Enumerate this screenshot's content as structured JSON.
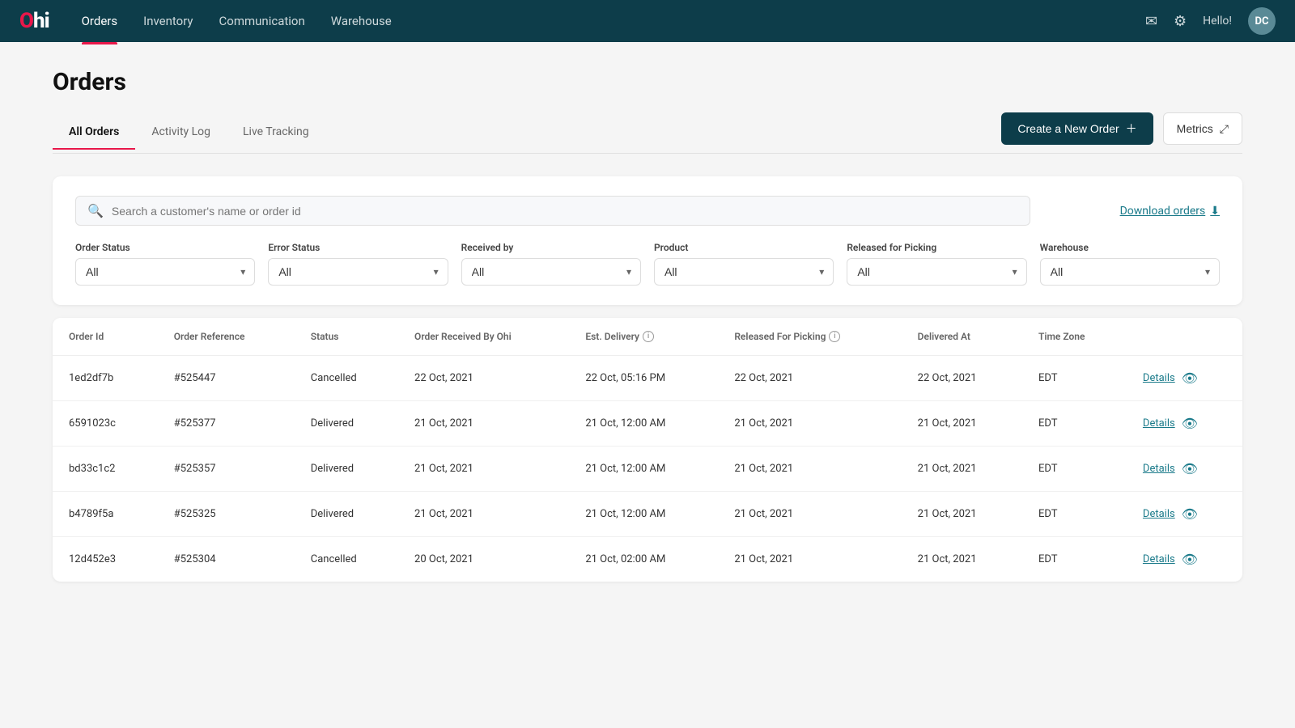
{
  "brand": {
    "logo_o": "O",
    "logo_hi": "hi"
  },
  "nav": {
    "links": [
      {
        "label": "Orders",
        "active": true
      },
      {
        "label": "Inventory",
        "active": false
      },
      {
        "label": "Communication",
        "active": false
      },
      {
        "label": "Warehouse",
        "active": false
      }
    ],
    "greeting": "Hello!",
    "user_initials": "DC"
  },
  "page": {
    "title": "Orders"
  },
  "tabs": [
    {
      "label": "All Orders",
      "active": true
    },
    {
      "label": "Activity Log",
      "active": false
    },
    {
      "label": "Live Tracking",
      "active": false
    }
  ],
  "actions": {
    "create_order": "Create a New Order",
    "metrics": "Metrics"
  },
  "search": {
    "placeholder": "Search a customer's name or order id"
  },
  "download": {
    "label": "Download orders"
  },
  "filters": [
    {
      "label": "Order Status",
      "value": "All"
    },
    {
      "label": "Error Status",
      "value": "All"
    },
    {
      "label": "Received by",
      "value": "All"
    },
    {
      "label": "Product",
      "value": "All"
    },
    {
      "label": "Released for Picking",
      "value": "All"
    },
    {
      "label": "Warehouse",
      "value": "All"
    }
  ],
  "table": {
    "columns": [
      {
        "label": "Order Id"
      },
      {
        "label": "Order Reference"
      },
      {
        "label": "Status"
      },
      {
        "label": "Order Received By Ohi"
      },
      {
        "label": "Est. Delivery",
        "info": true
      },
      {
        "label": "Released For Picking",
        "info": true
      },
      {
        "label": "Delivered At"
      },
      {
        "label": "Time Zone"
      },
      {
        "label": ""
      }
    ],
    "rows": [
      {
        "order_id": "1ed2df7b",
        "order_ref": "#525447",
        "status": "Cancelled",
        "received": "22 Oct, 2021",
        "est_delivery": "22 Oct, 05:16 PM",
        "released": "22 Oct, 2021",
        "delivered": "22 Oct, 2021",
        "timezone": "EDT"
      },
      {
        "order_id": "6591023c",
        "order_ref": "#525377",
        "status": "Delivered",
        "received": "21 Oct, 2021",
        "est_delivery": "21 Oct, 12:00 AM",
        "released": "21 Oct, 2021",
        "delivered": "21 Oct, 2021",
        "timezone": "EDT"
      },
      {
        "order_id": "bd33c1c2",
        "order_ref": "#525357",
        "status": "Delivered",
        "received": "21 Oct, 2021",
        "est_delivery": "21 Oct, 12:00 AM",
        "released": "21 Oct, 2021",
        "delivered": "21 Oct, 2021",
        "timezone": "EDT"
      },
      {
        "order_id": "b4789f5a",
        "order_ref": "#525325",
        "status": "Delivered",
        "received": "21 Oct, 2021",
        "est_delivery": "21 Oct, 12:00 AM",
        "released": "21 Oct, 2021",
        "delivered": "21 Oct, 2021",
        "timezone": "EDT"
      },
      {
        "order_id": "12d452e3",
        "order_ref": "#525304",
        "status": "Cancelled",
        "received": "20 Oct, 2021",
        "est_delivery": "21 Oct, 02:00 AM",
        "released": "21 Oct, 2021",
        "delivered": "21 Oct, 2021",
        "timezone": "EDT"
      }
    ],
    "details_label": "Details"
  }
}
